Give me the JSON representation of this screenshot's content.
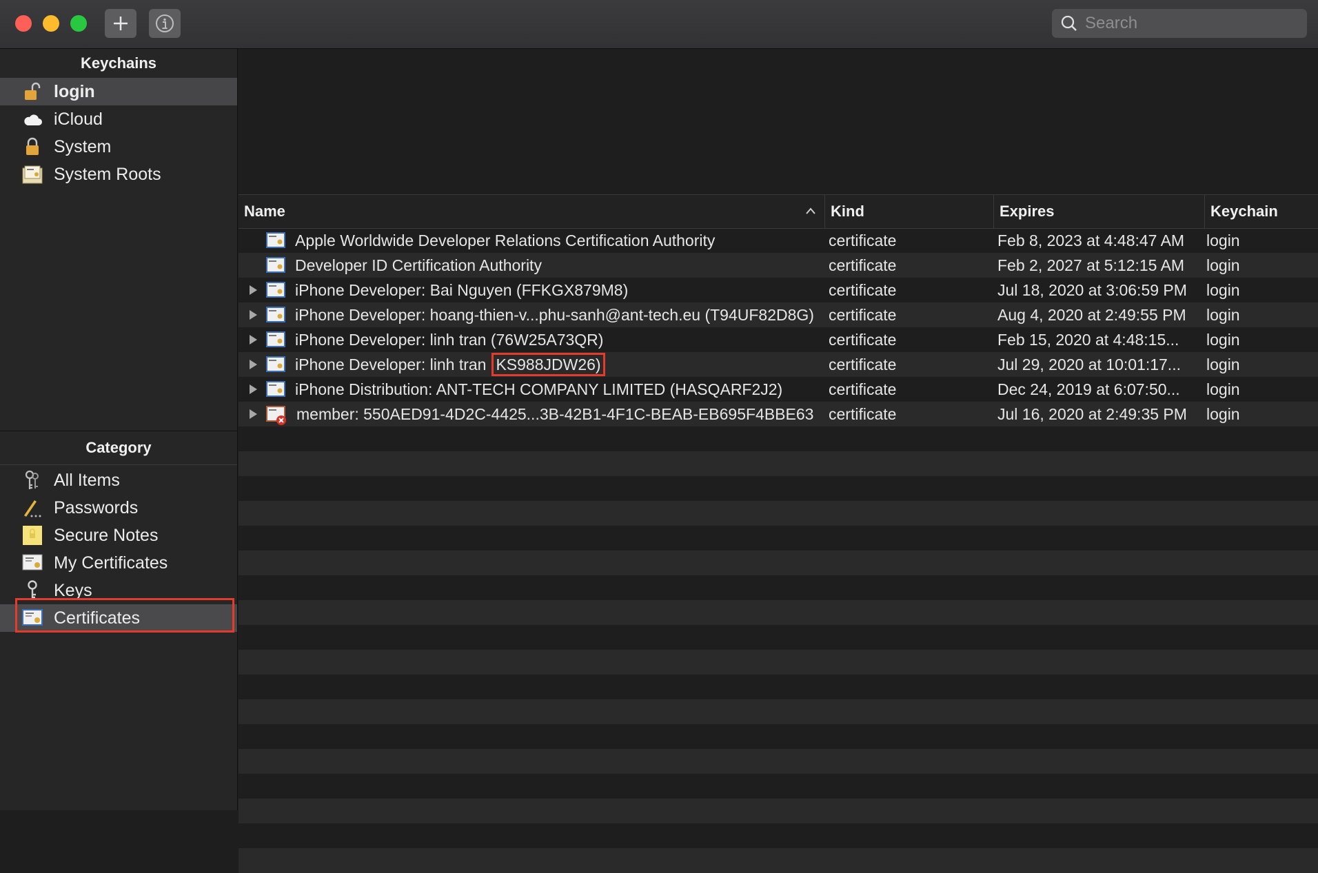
{
  "toolbar": {
    "add_icon": "plus-icon",
    "info_icon": "info-icon",
    "search_placeholder": "Search"
  },
  "sidebar": {
    "keychains_header": "Keychains",
    "keychains": [
      {
        "label": "login",
        "icon": "open-lock-icon"
      },
      {
        "label": "iCloud",
        "icon": "cloud-icon"
      },
      {
        "label": "System",
        "icon": "lock-icon"
      },
      {
        "label": "System Roots",
        "icon": "certificate-folder-icon"
      }
    ],
    "category_header": "Category",
    "categories": [
      {
        "label": "All Items",
        "icon": "keys-icon"
      },
      {
        "label": "Passwords",
        "icon": "pen-icon"
      },
      {
        "label": "Secure Notes",
        "icon": "note-icon"
      },
      {
        "label": "My Certificates",
        "icon": "certificate-icon"
      },
      {
        "label": "Keys",
        "icon": "key-icon"
      },
      {
        "label": "Certificates",
        "icon": "certificate-icon"
      }
    ]
  },
  "table": {
    "columns": {
      "name": "Name",
      "kind": "Kind",
      "expires": "Expires",
      "keychain": "Keychain"
    },
    "rows": [
      {
        "name": "Apple Worldwide Developer Relations Certification Authority",
        "kind": "certificate",
        "expires": "Feb 8, 2023 at 4:48:47 AM",
        "keychain": "login"
      },
      {
        "name": "Developer ID Certification Authority",
        "kind": "certificate",
        "expires": "Feb 2, 2027 at 5:12:15 AM",
        "keychain": "login"
      },
      {
        "name": "iPhone Developer: Bai Nguyen (FFKGX879M8)",
        "kind": "certificate",
        "expires": "Jul 18, 2020 at 3:06:59 PM",
        "keychain": "login"
      },
      {
        "name": "iPhone Developer: hoang-thien-v...phu-sanh@ant-tech.eu (T94UF82D8G)",
        "kind": "certificate",
        "expires": "Aug 4, 2020 at 2:49:55 PM",
        "keychain": "login"
      },
      {
        "name": "iPhone Developer: linh tran (76W25A73QR)",
        "kind": "certificate",
        "expires": "Feb 15, 2020 at 4:48:15...",
        "keychain": "login"
      },
      {
        "name_prefix": "iPhone Developer: linh tran",
        "name_highlight": "KS988JDW26)",
        "kind": "certificate",
        "expires": "Jul 29, 2020 at 10:01:17...",
        "keychain": "login"
      },
      {
        "name": "iPhone Distribution: ANT-TECH COMPANY LIMITED (HASQARF2J2)",
        "kind": "certificate",
        "expires": "Dec 24, 2019 at 6:07:50...",
        "keychain": "login"
      },
      {
        "name": "member: 550AED91-4D2C-4425...3B-42B1-4F1C-BEAB-EB695F4BBE63",
        "kind": "certificate",
        "expires": "Jul 16, 2020 at 2:49:35 PM",
        "keychain": "login"
      }
    ]
  },
  "colors": {
    "highlight": "#e53b2c",
    "accent_red": "#fe5f57",
    "accent_yellow": "#febb2e",
    "accent_green": "#28c840"
  }
}
